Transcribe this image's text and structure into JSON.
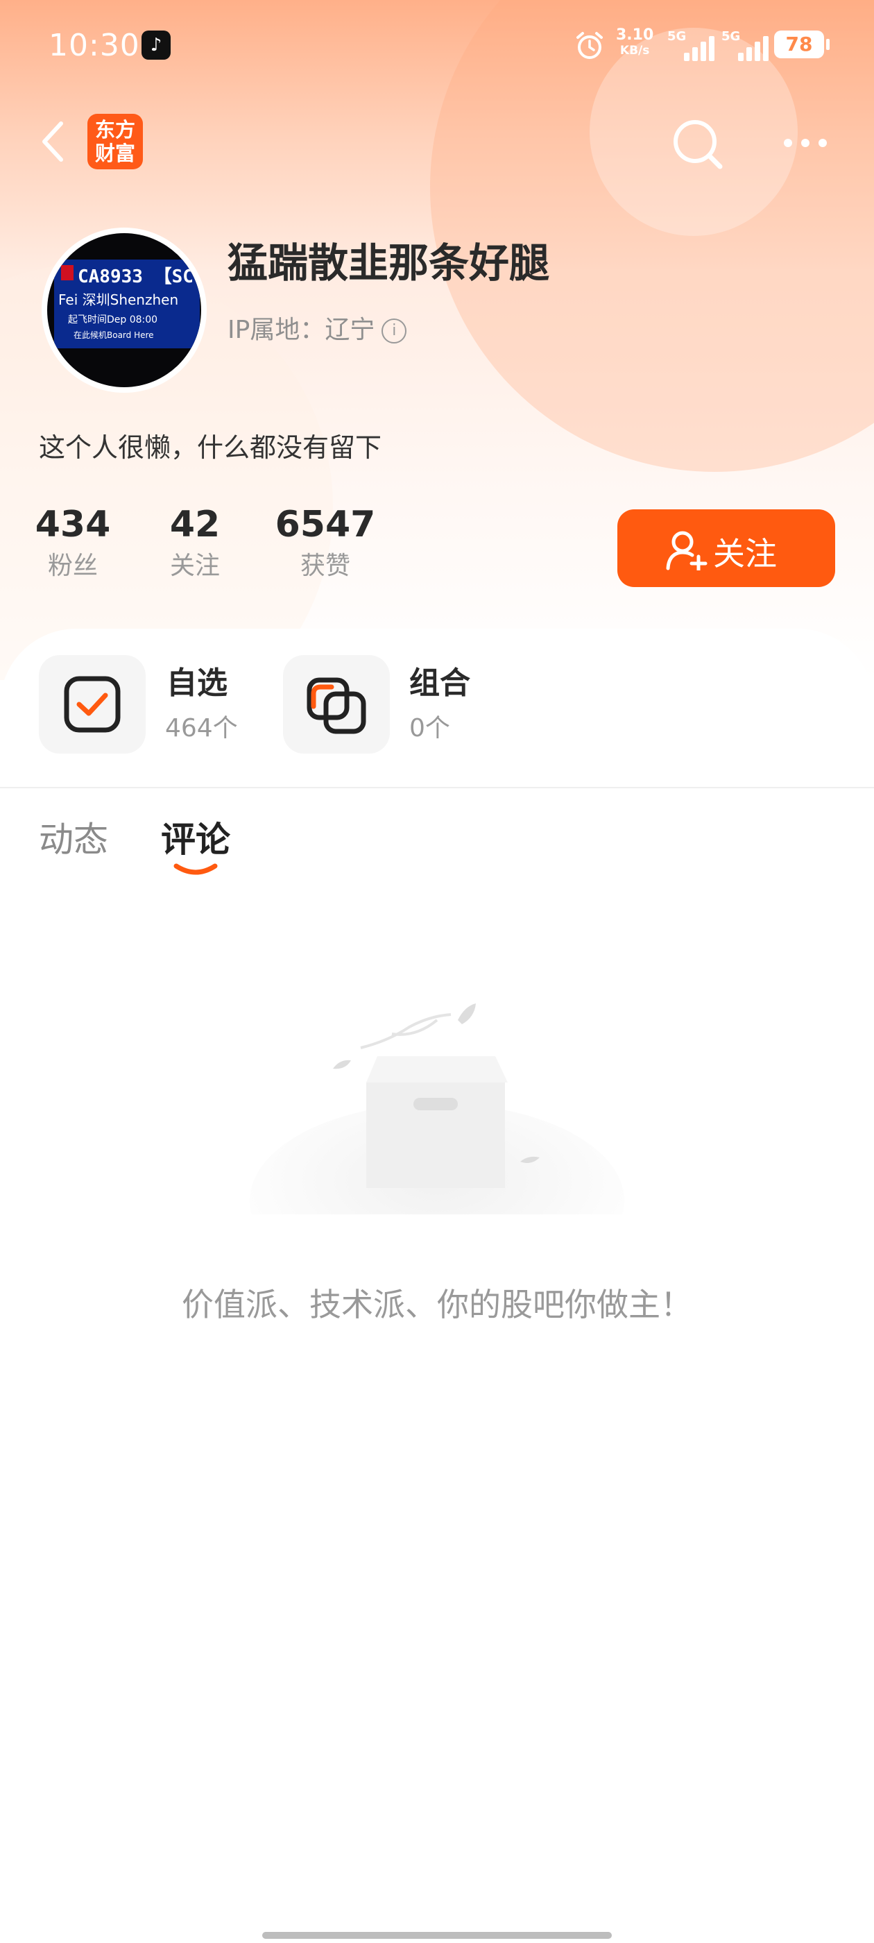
{
  "status_bar": {
    "time": "10:30",
    "net_speed": "3.10",
    "net_unit": "KB/s",
    "sim1": "5G",
    "sim2": "5G",
    "battery": "78"
  },
  "nav": {
    "logo_line1": "东方",
    "logo_line2": "财富"
  },
  "profile": {
    "username": "猛踹散韭那条好腿",
    "ip_label": "IP属地：辽宁",
    "bio": "这个人很懒，什么都没有留下",
    "avatar_board": {
      "line1": "CA8933 【SC",
      "line2": "Fei 深圳Shenzhen",
      "line3": "起飞时间Dep    08:00",
      "line4": "在此候机Board Here"
    }
  },
  "stats": [
    {
      "value": "434",
      "label": "粉丝"
    },
    {
      "value": "42",
      "label": "关注"
    },
    {
      "value": "6547",
      "label": "获赞"
    }
  ],
  "follow_button": "关注",
  "cards": [
    {
      "title": "自选",
      "subtitle": "464个",
      "icon": "checkbox-icon"
    },
    {
      "title": "组合",
      "subtitle": "0个",
      "icon": "overlap-squares-icon"
    }
  ],
  "tabs": [
    {
      "label": "动态",
      "active": false
    },
    {
      "label": "评论",
      "active": true
    }
  ],
  "empty_state": {
    "message": "价值派、技术派、你的股吧你做主！"
  },
  "colors": {
    "accent": "#ff5a10",
    "header_gradient_top": "#ffb089"
  }
}
